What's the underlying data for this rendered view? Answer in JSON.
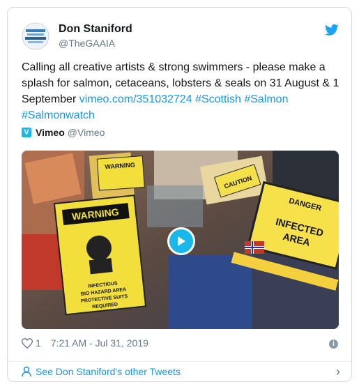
{
  "author": {
    "name": "Don Staniford",
    "handle": "@TheGAAIA"
  },
  "tweet": {
    "text_plain": "Calling all creative artists & strong swimmers - please make a splash for salmon, cetaceans, lobsters & seals on 31 August & 1 September ",
    "link": "vimeo.com/351032724",
    "hashtags": [
      "#Scottish",
      "#Salmon",
      "#Salmonwatch"
    ]
  },
  "source": {
    "name": "Vimeo",
    "handle": "@Vimeo",
    "logo_letter": "V"
  },
  "media": {
    "sign1": "WARNING",
    "sign1_text": "INFECTIOUS BIO HAZARD AREA PROTECTIVE SUITS REQUIRED",
    "sign2_top": "DANGER",
    "sign2_text": "INFECTED AREA",
    "caution": "CAUTION",
    "warning_small": "WARNING"
  },
  "footer": {
    "likes": "1",
    "timestamp": "7:21 AM - Jul 31, 2019",
    "more_tweets": "See Don Staniford's other Tweets"
  },
  "colors": {
    "link": "#1b95e0",
    "vimeo": "#1ab7ea",
    "twitter": "#1da1f2"
  }
}
